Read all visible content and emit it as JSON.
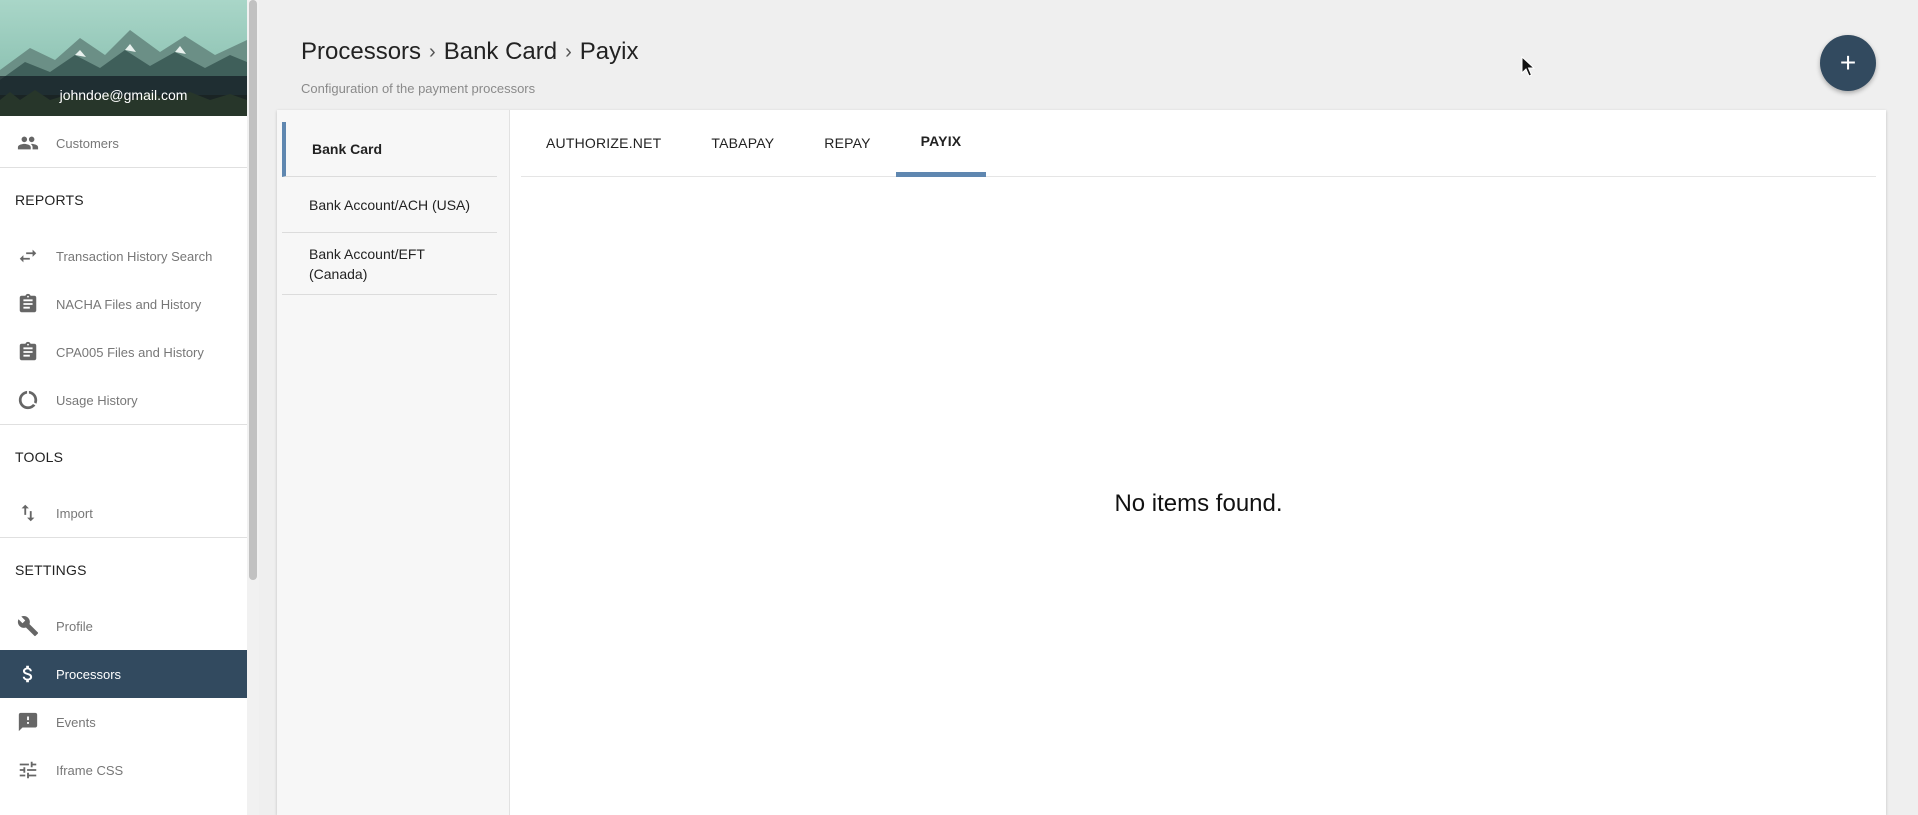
{
  "user": {
    "email": "johndoe@gmail.com"
  },
  "sidebar": {
    "top_item": {
      "label": "Customers",
      "icon": "people-icon"
    },
    "reports": {
      "header": "REPORTS",
      "items": [
        {
          "label": "Transaction History Search",
          "icon": "swap-arrows-icon"
        },
        {
          "label": "NACHA Files and History",
          "icon": "clipboard-icon"
        },
        {
          "label": "CPA005 Files and History",
          "icon": "clipboard-icon"
        },
        {
          "label": "Usage History",
          "icon": "circle-progress-icon"
        }
      ]
    },
    "tools": {
      "header": "TOOLS",
      "items": [
        {
          "label": "Import",
          "icon": "import-arrows-icon"
        }
      ]
    },
    "settings": {
      "header": "SETTINGS",
      "items": [
        {
          "label": "Profile",
          "icon": "wrench-icon"
        },
        {
          "label": "Processors",
          "icon": "dollar-icon",
          "active": true
        },
        {
          "label": "Events",
          "icon": "feedback-icon"
        },
        {
          "label": "Iframe CSS",
          "icon": "sliders-icon"
        }
      ]
    }
  },
  "page": {
    "breadcrumb": [
      "Processors",
      "Bank Card",
      "Payix"
    ],
    "subtitle": "Configuration of the payment processors",
    "fab_label": "+"
  },
  "processor_categories": {
    "items": [
      "Bank Card",
      "Bank Account/ACH (USA)",
      "Bank Account/EFT (Canada)"
    ],
    "active": "Bank Card"
  },
  "tabs": {
    "items": [
      "AUTHORIZE.NET",
      "TABAPAY",
      "REPAY",
      "PAYIX"
    ],
    "active": "PAYIX"
  },
  "empty_state": "No items found.",
  "colors": {
    "accent": "#324a5f",
    "tab_indicator": "#5f87b0",
    "background": "#efefef"
  }
}
